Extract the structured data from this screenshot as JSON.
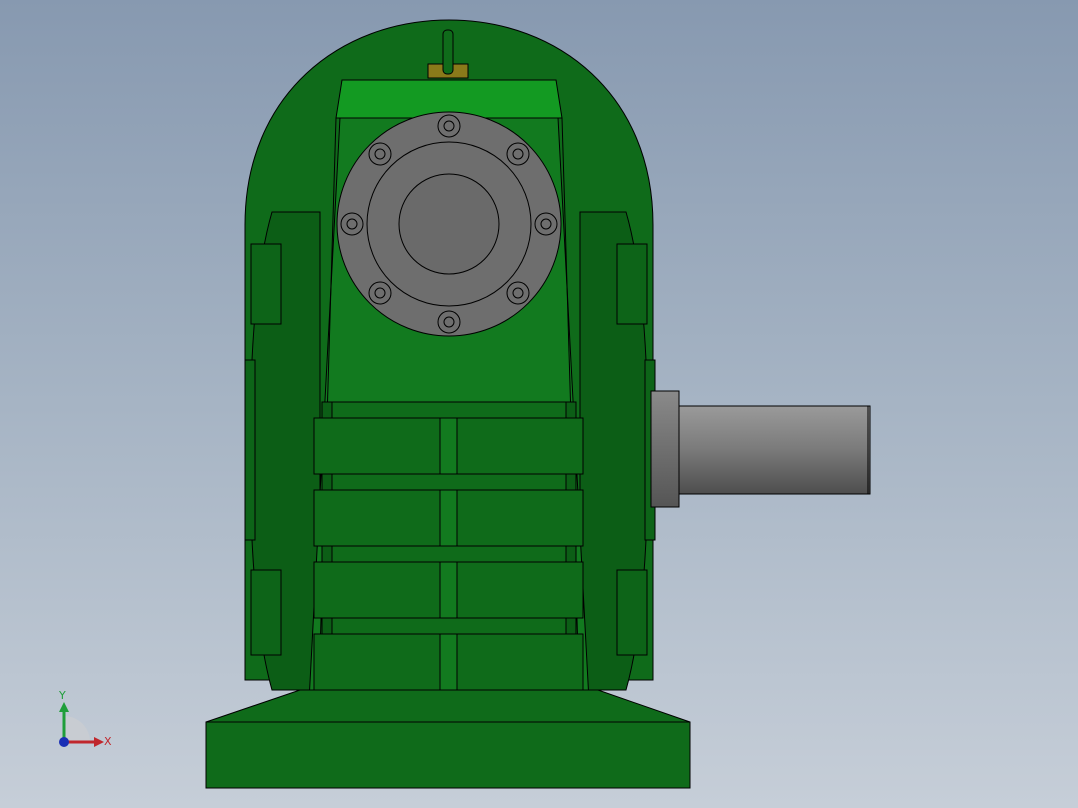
{
  "viewport": {
    "background_top": "#8799b0",
    "background_bottom": "#c6ced8"
  },
  "model": {
    "body_color": "#0f6b1a",
    "body_dark": "#0a4f13",
    "body_light": "#168a22",
    "flange_color": "#6e6e6e",
    "shaft_color": "#7a7a7a",
    "edge_color": "#000000"
  },
  "triad": {
    "x_label": "X",
    "y_label": "Y",
    "x_color": "#c0272d",
    "y_color": "#1f9e3a",
    "z_color": "#1a2fb5"
  }
}
